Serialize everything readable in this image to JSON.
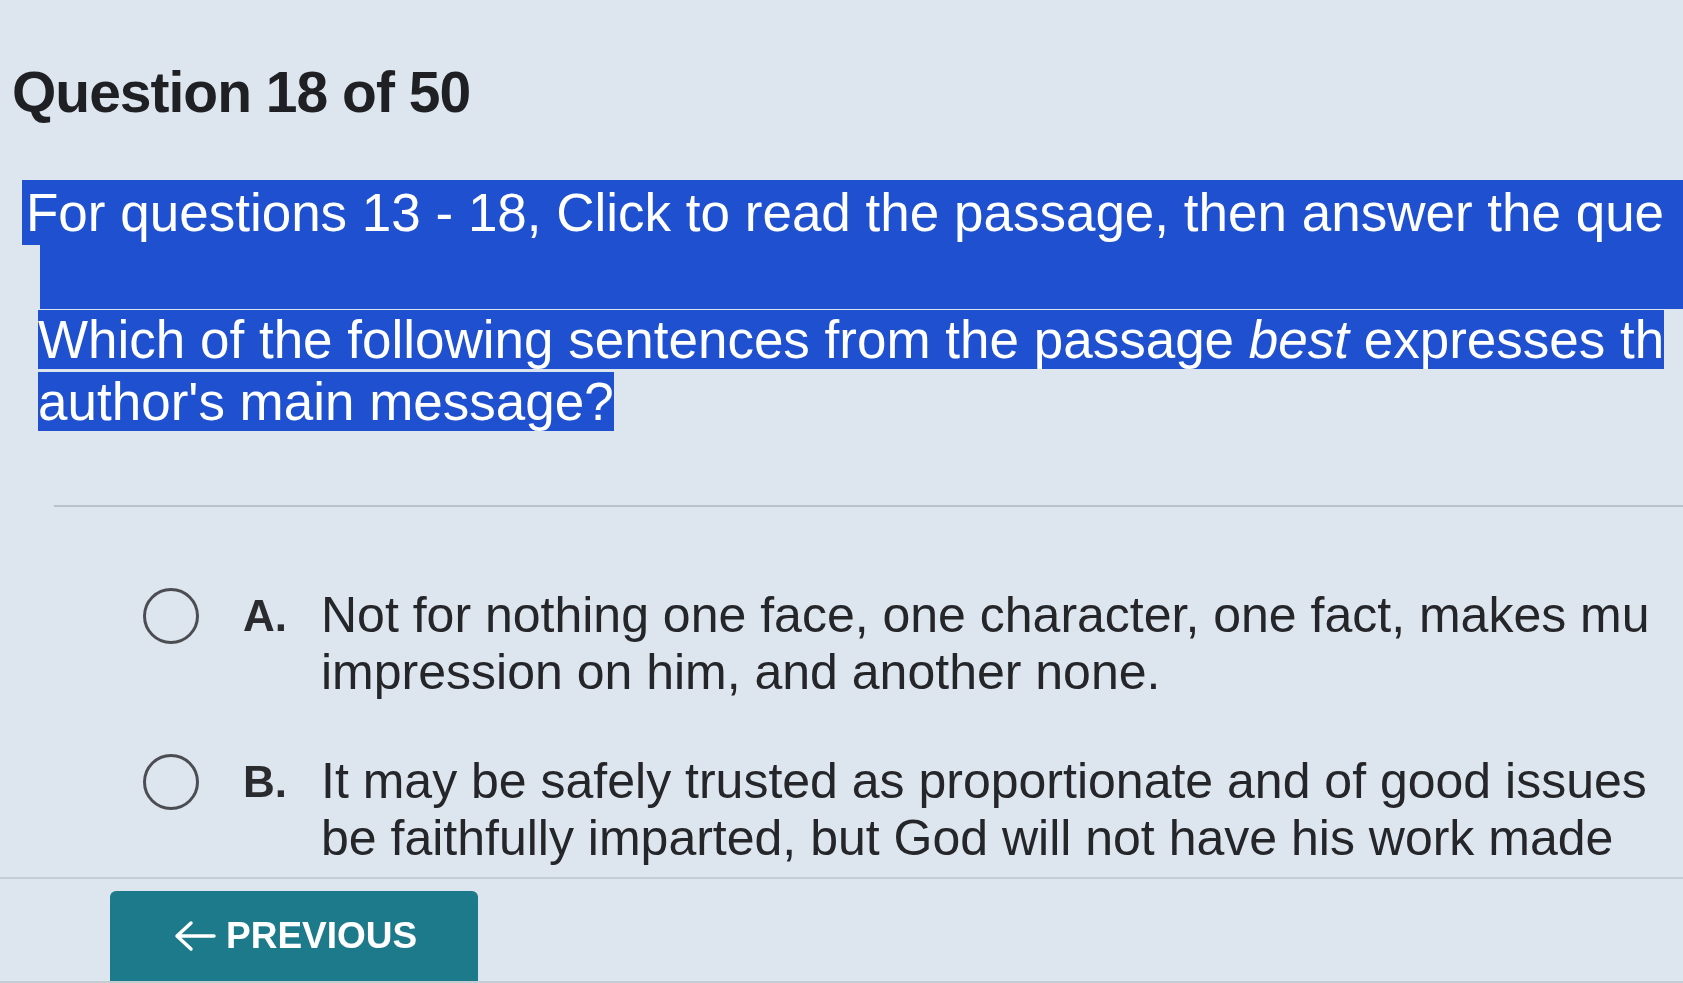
{
  "header": {
    "title": "Question 18 of 50"
  },
  "question": {
    "highlighted": true,
    "instruction": "For questions 13 - 18, Click to read the passage, then answer the que",
    "prompt_lines": [
      "Which of the following sentences from the passage *best* expresses th",
      "author's main message?"
    ]
  },
  "answers": [
    {
      "letter": "A.",
      "selected": false,
      "lines": [
        "Not for nothing one face, one character, one fact, makes mu",
        "impression on him, and another none."
      ]
    },
    {
      "letter": "B.",
      "selected": false,
      "lines": [
        "It may be safely trusted as proportionate and of good issues",
        "be faithfully imparted, but God will not have his work made"
      ]
    }
  ],
  "footer": {
    "previous_button": {
      "label": "PREVIOUS"
    }
  }
}
